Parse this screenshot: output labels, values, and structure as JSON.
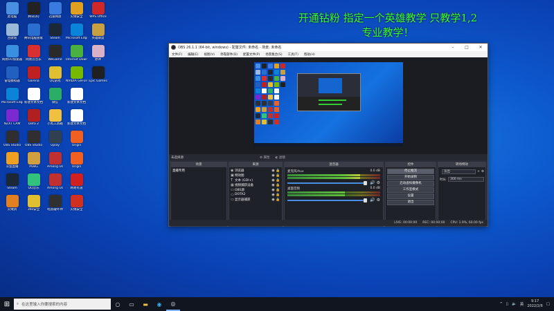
{
  "overlay": {
    "line1": "开通钻粉 指定一个英雄教学 只教学1,2",
    "line2": "专业教学！"
  },
  "desktop_icons": [
    {
      "label": "此电脑",
      "color": "#4a90e2"
    },
    {
      "label": "腾讯QQ",
      "color": "#222222"
    },
    {
      "label": "迅雷网盘",
      "color": "#3a7be0"
    },
    {
      "label": "火绒安全",
      "color": "#e0a020"
    },
    {
      "label": "WPS Office",
      "color": "#d02828"
    },
    {
      "label": "回收站",
      "color": "#9ab8d8"
    },
    {
      "label": "腾讯电脑管家",
      "color": "#2a6fd0"
    },
    {
      "label": "Steam",
      "color": "#1b2838"
    },
    {
      "label": "Microsoft Edge",
      "color": "#0a84d8"
    },
    {
      "label": "英雄联盟",
      "color": "#c8a040"
    },
    {
      "label": "网易UU加速器",
      "color": "#3a90e0"
    },
    {
      "label": "网易云音乐",
      "color": "#d83030"
    },
    {
      "label": "WeGame",
      "color": "#2a2a2a"
    },
    {
      "label": "Internet Download",
      "color": "#4ab040"
    },
    {
      "label": "原神",
      "color": "#d8b0c8"
    },
    {
      "label": "雷电模拟器",
      "color": "#2060c0"
    },
    {
      "label": "Garena",
      "color": "#c02020"
    },
    {
      "label": "QQ游戏",
      "color": "#e0c030"
    },
    {
      "label": "NVIDIA GeForce",
      "color": "#76b900"
    },
    {
      "label": "Epic Games",
      "color": "#202020"
    },
    {
      "label": "Microsoft Edge",
      "color": "#0a84d8"
    },
    {
      "label": "新建文本文档",
      "color": "#ffffff"
    },
    {
      "label": "微信",
      "color": "#2aae67"
    },
    {
      "label": "新建文本文档",
      "color": "#ffffff"
    },
    {
      "label": "",
      "color": "transparent"
    },
    {
      "label": "NZXT CAM",
      "color": "#7a2ad0"
    },
    {
      "label": "Dota 2",
      "color": "#b02020"
    },
    {
      "label": "小丸工具箱",
      "color": "#f0c040"
    },
    {
      "label": "新建文本文档",
      "color": "#ffffff"
    },
    {
      "label": "",
      "color": "transparent"
    },
    {
      "label": "OBS Studio",
      "color": "#302e31"
    },
    {
      "label": "OBS Studio",
      "color": "#302e31"
    },
    {
      "label": "Uplay",
      "color": "#304050"
    },
    {
      "label": "Origin",
      "color": "#f06020"
    },
    {
      "label": "",
      "color": "transparent"
    },
    {
      "label": "斗鱼直播",
      "color": "#f0a020"
    },
    {
      "label": "PUBG",
      "color": "#d0a040"
    },
    {
      "label": "Among Us",
      "color": "#c03030"
    },
    {
      "label": "Origin",
      "color": "#f06020"
    },
    {
      "label": "",
      "color": "transparent"
    },
    {
      "label": "Steam",
      "color": "#1b2838"
    },
    {
      "label": "QQ音乐",
      "color": "#31c27c"
    },
    {
      "label": "Among Us",
      "color": "#c03030"
    },
    {
      "label": "网易有道",
      "color": "#d02020"
    },
    {
      "label": "",
      "color": "transparent"
    },
    {
      "label": "火绒剑",
      "color": "#e08020"
    },
    {
      "label": "360安全",
      "color": "#e0c030"
    },
    {
      "label": "暗黑破坏神",
      "color": "#303030"
    },
    {
      "label": "火绒安全",
      "color": "#d03020"
    },
    {
      "label": "",
      "color": "transparent"
    }
  ],
  "obs": {
    "title": "OBS 26.1.1 (64-bit, windows) - 配置文件: 未命名 - 场景: 未命名",
    "menu": [
      "文件(F)",
      "编辑(E)",
      "视图(V)",
      "停靠部件(D)",
      "配置文件(P)",
      "场景集合(S)",
      "工具(T)",
      "帮助(H)"
    ],
    "scene_bar": {
      "label": "未选择源",
      "props": "属性",
      "filters": "滤镜"
    },
    "scenes": {
      "header": "场景",
      "items": [
        "直播专用"
      ]
    },
    "sources": {
      "header": "来源",
      "items": [
        {
          "icon": "browser-icon",
          "glyph": "◉",
          "name": "浏览器"
        },
        {
          "icon": "image-icon",
          "glyph": "▣",
          "name": "特效图"
        },
        {
          "icon": "text-icon",
          "glyph": "T",
          "name": "文本 (GDI+)"
        },
        {
          "icon": "camera-icon",
          "glyph": "▦",
          "name": "视频捕获设备"
        },
        {
          "icon": "window-icon",
          "glyph": "▭",
          "name": "OBS源"
        },
        {
          "icon": "window-icon",
          "glyph": "▭",
          "name": "DOTA2"
        },
        {
          "icon": "monitor-icon",
          "glyph": "▭",
          "name": "显示器捕获"
        }
      ]
    },
    "mixer": {
      "header": "混音器",
      "channels": [
        {
          "name": "麦克风/Aux",
          "db": "0.0 dB",
          "level": 0.78
        },
        {
          "name": "桌面音频",
          "db": "0.0 dB",
          "level": 0.62
        }
      ]
    },
    "controls": {
      "header": "控件",
      "buttons": [
        "停止推流",
        "开始录制",
        "启动虚拟摄像机",
        "工作室模式",
        "设置",
        "退出"
      ]
    },
    "transitions": {
      "header": "转场特效",
      "type": "淡出",
      "duration_label": "时长",
      "duration": "300 ms"
    },
    "status": {
      "live": "LIVE: 00:00:00",
      "rec": "REC: 00:00:00",
      "cpu": "CPU: 1.9%, 60.00 fps"
    }
  },
  "taskbar": {
    "search_placeholder": "在这里输入你要搜索的内容",
    "time": "9:17",
    "date": "2022/2/6",
    "lang": "英"
  },
  "colors": {
    "overlay_text": "#3cff3c",
    "obs_bg": "#2b2e38",
    "accent": "#4a90e2"
  }
}
